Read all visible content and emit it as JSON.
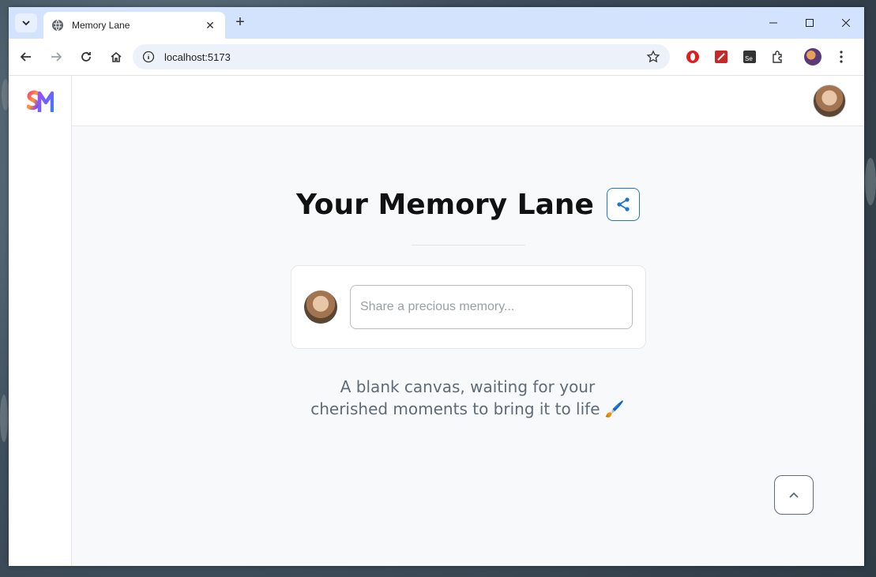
{
  "browser": {
    "tab_title": "Memory Lane",
    "url": "localhost:5173"
  },
  "page": {
    "title": "Your Memory Lane",
    "input_placeholder": "Share a precious memory...",
    "empty_line1": "A blank canvas, waiting for your",
    "empty_line2": "cherished moments to bring it to life 🖌️"
  },
  "colors": {
    "accent": "#1976d2",
    "tabstrip": "#d3e3fd"
  },
  "icons": [
    "globe-icon",
    "close-icon",
    "plus-icon",
    "back-icon",
    "forward-icon",
    "reload-icon",
    "home-icon",
    "info-icon",
    "star-icon",
    "share-icon",
    "chevron-up-icon"
  ]
}
